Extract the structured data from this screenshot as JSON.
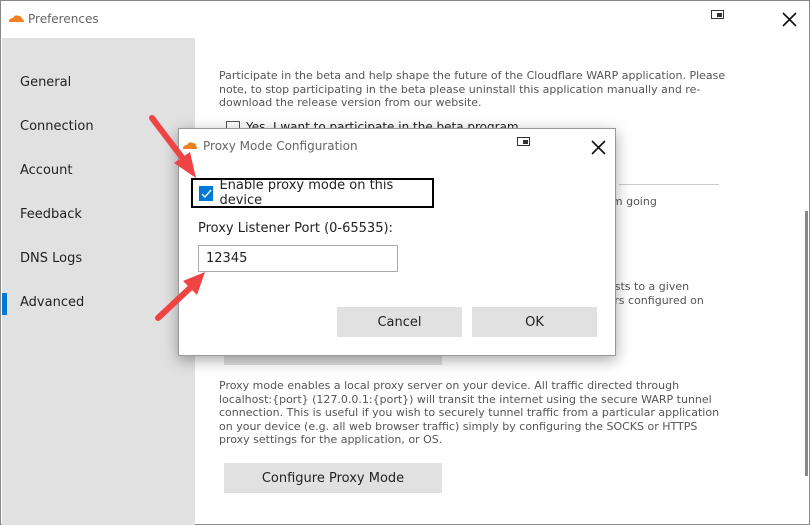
{
  "window": {
    "title": "Preferences"
  },
  "sidebar": {
    "items": [
      {
        "label": "General"
      },
      {
        "label": "Connection"
      },
      {
        "label": "Account"
      },
      {
        "label": "Feedback"
      },
      {
        "label": "DNS Logs"
      },
      {
        "label": "Advanced",
        "active": true
      }
    ]
  },
  "main": {
    "beta_text": "Participate in the beta and help shape the future of the Cloudflare WARP application. Please note, to stop participating in the beta please uninstall this application manually and re-download the release version from our website.",
    "beta_checkbox_label": "Yes, I want to participate in the beta program",
    "fragment_1": "from going",
    "fragment_2": "uests to a given",
    "fragment_3": "vers configured on",
    "proxy_text": "Proxy mode enables a local proxy server on your device. All traffic directed through localhost:{port} (127.0.0.1:{port}) will transit the internet using the secure WARP tunnel connection. This is useful if you wish to securely tunnel traffic from a particular application on your device (e.g. all web browser traffic) simply by configuring the SOCKS or HTTPS proxy settings for the application, or OS.",
    "configure_button": "Configure Proxy Mode"
  },
  "dialog": {
    "title": "Proxy Mode Configuration",
    "enable_label": "Enable proxy mode on this device",
    "enable_checked": true,
    "port_label": "Proxy Listener Port (0-65535):",
    "port_value": "12345",
    "cancel": "Cancel",
    "ok": "OK"
  },
  "colors": {
    "accent": "#0078d7",
    "brand": "#f38020",
    "annotation_arrow": "#f04444"
  }
}
